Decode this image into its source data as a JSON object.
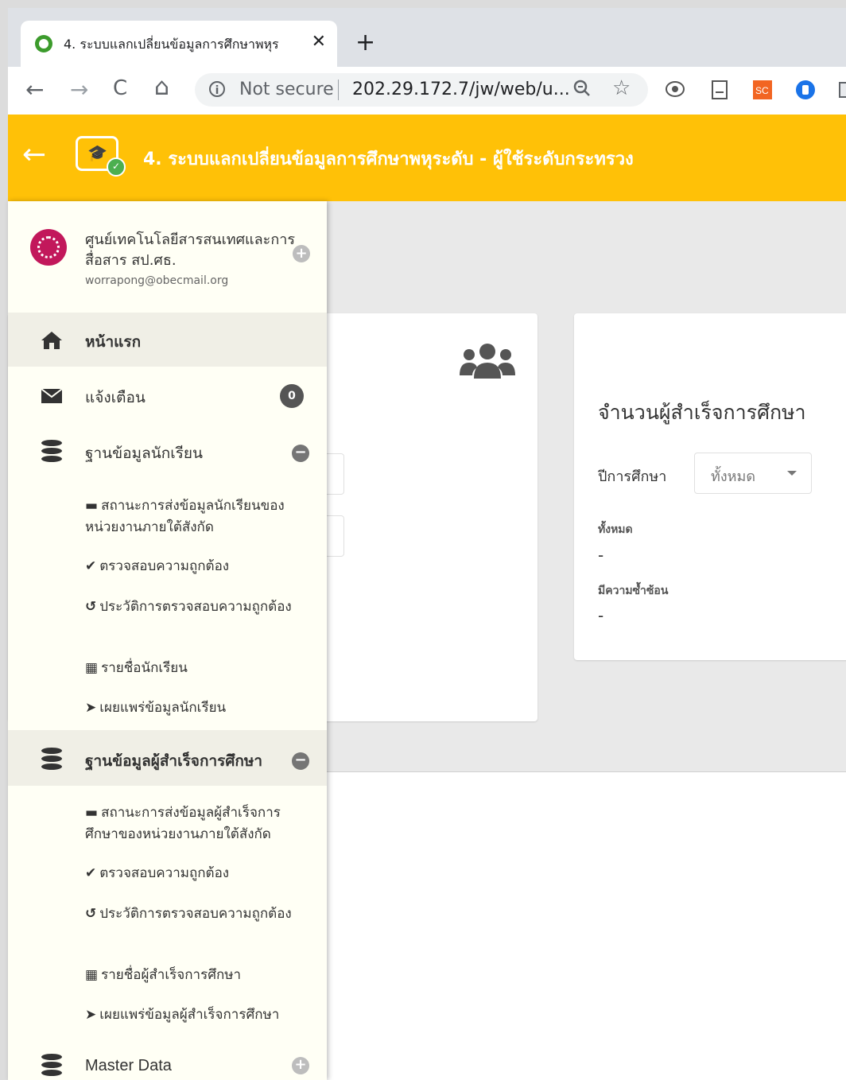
{
  "browser": {
    "tab_title": "4. ระบบแลกเปลี่ยนข้อมูลการศึกษาพหุร",
    "tab_close": "✕",
    "new_tab": "+",
    "back": "←",
    "forward": "→",
    "reload": "C",
    "home": "⌂",
    "security": "Not secure",
    "url": "202.29.172.7/jw/web/u..."
  },
  "app_header": {
    "title": "4. ระบบแลกเปลี่ยนข้อมูลการศึกษาพหุระดับ - ผู้ใช้ระดับกระทรวง",
    "color": "#ffc107"
  },
  "profile": {
    "name": "ศูนย์เทคโนโลยีสารสนเทศและการสื่อสาร สป.ศธ.",
    "email": "worrapong@obecmail.org"
  },
  "nav": {
    "home": "หน้าแรก",
    "notifications": "แจ้งเตือน",
    "notifications_count": "0",
    "student_db": "ฐานข้อมูลนักเรียน",
    "student_items": [
      {
        "glyph": "▬",
        "label": "สถานะการส่งข้อมูลนักเรียนของหน่วยงานภายใต้สังกัด"
      },
      {
        "glyph": "✔",
        "label": "ตรวจสอบความถูกต้อง"
      },
      {
        "glyph": "↺",
        "label": "ประวัติการตรวจสอบความถูกต้อง"
      },
      {
        "glyph": "▦",
        "label": "รายชื่อนักเรียน"
      },
      {
        "glyph": "➤",
        "label": "เผยแพร่ข้อมูลนักเรียน"
      }
    ],
    "graduate_db": "ฐานข้อมูลผู้สำเร็จการศึกษา",
    "graduate_items": [
      {
        "glyph": "▬",
        "label": "สถานะการส่งข้อมูลผู้สำเร็จการศึกษาของหน่วยงานภายใต้สังกัด"
      },
      {
        "glyph": "✔",
        "label": "ตรวจสอบความถูกต้อง"
      },
      {
        "glyph": "↺",
        "label": "ประวัติการตรวจสอบความถูกต้อง"
      },
      {
        "glyph": "▦",
        "label": "รายชื่อผู้สำเร็จการศึกษา"
      },
      {
        "glyph": "➤",
        "label": "เผยแพร่ข้อมูลผู้สำเร็จการศึกษา"
      }
    ],
    "master_data": "Master Data"
  },
  "graduate_card": {
    "title": "จำนวนผู้สำเร็จการศึกษา",
    "year_label": "ปีการศึกษา",
    "year_value": "ทั้งหมด",
    "total_label": "ทั้งหมด",
    "total_value": "-",
    "duplicate_label": "มีความซ้ำซ้อน",
    "duplicate_value": "-"
  }
}
